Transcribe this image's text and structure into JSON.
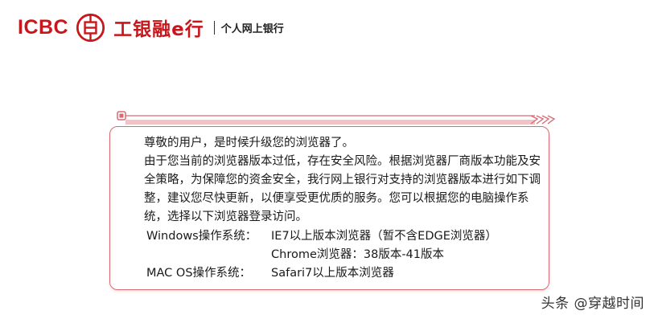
{
  "header": {
    "brand_en": "ICBC",
    "brand_cn": "工银融e行",
    "divider": "|",
    "subtitle": "个人网上银行",
    "logo_icon": "icbc-logo-icon",
    "brand_color": "#c8161d"
  },
  "notice": {
    "greeting": "尊敬的用户，是时候升级您的浏览器了。",
    "body": "由于您当前的浏览器版本过低，存在安全风险。根据浏览器厂商版本功能及安全策略，为保障您的资金安全，我行网上银行对支持的浏览器版本进行如下调整，建议您尽快更新，以便享受更优质的服务。您可以根据您的电脑操作系统，选择以下浏览器登录访问。",
    "browsers": [
      {
        "os": "Windows操作系统：",
        "requirement": "IE7以上版本浏览器（暂不含EDGE浏览器）"
      },
      {
        "os": "",
        "requirement": "Chrome浏览器：38版本-41版本"
      },
      {
        "os": "MAC OS操作系统：",
        "requirement": "Safari7以上版本浏览器"
      }
    ],
    "border_color": "#d96a73"
  },
  "watermark": {
    "text": "头条 @穿越时间"
  }
}
